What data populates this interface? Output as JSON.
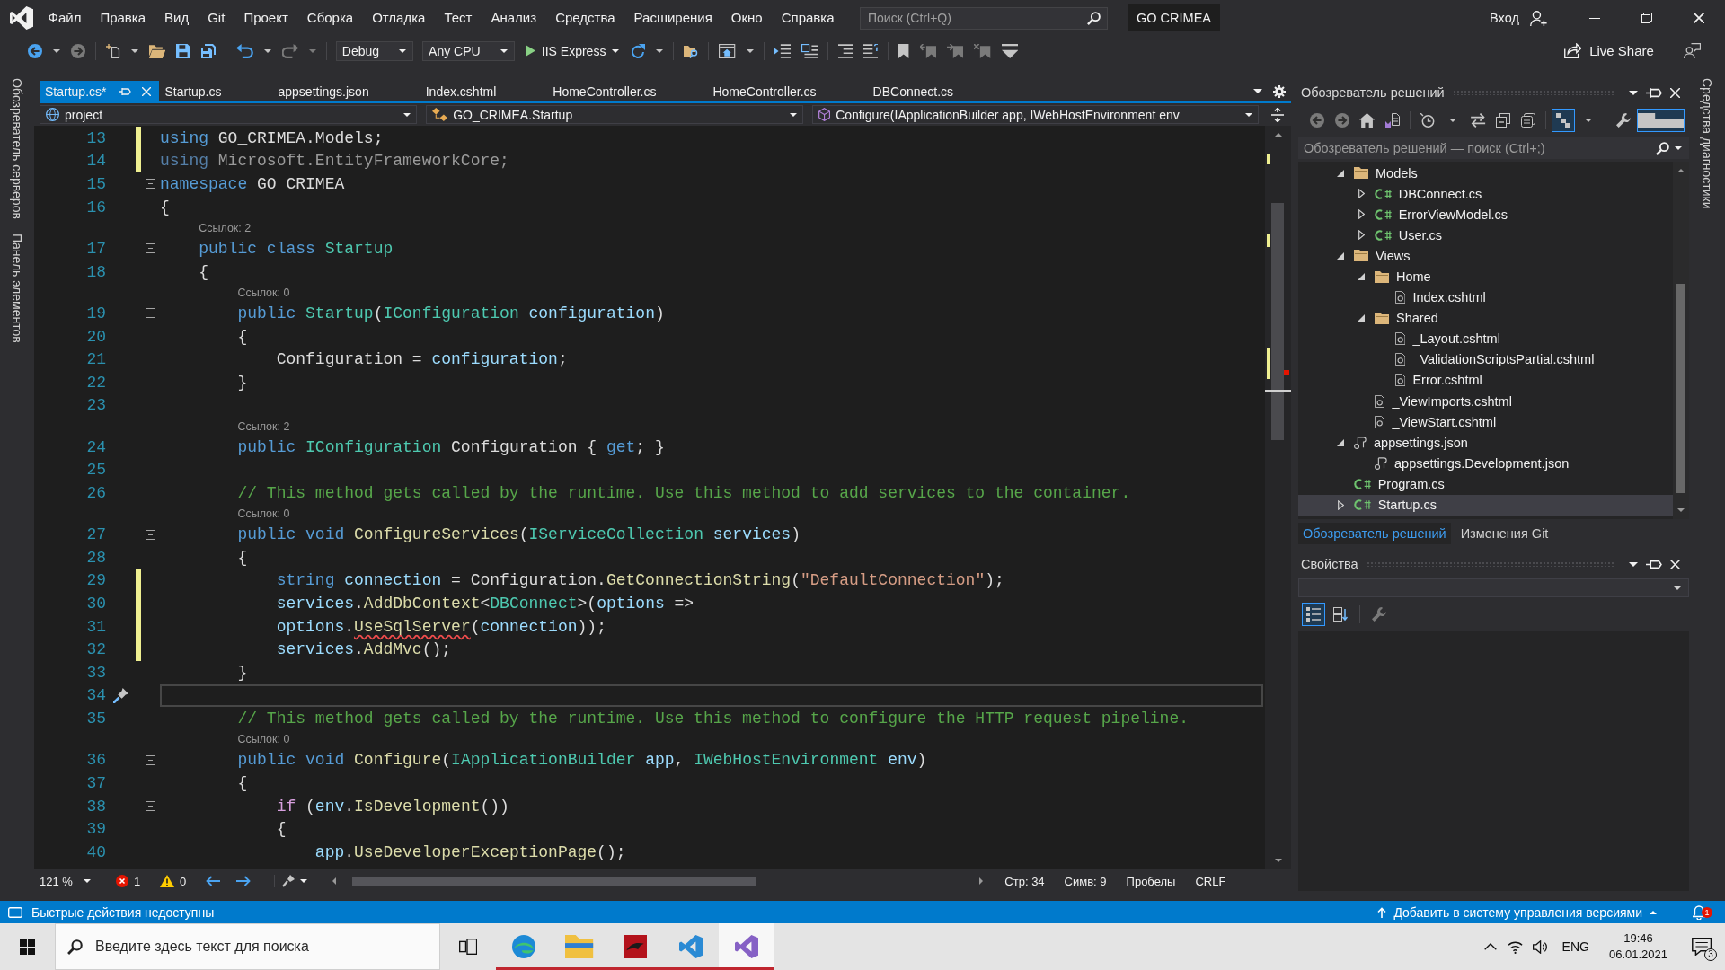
{
  "title_bar": {
    "menu": [
      "Файл",
      "Правка",
      "Вид",
      "Git",
      "Проект",
      "Сборка",
      "Отладка",
      "Тест",
      "Анализ",
      "Средства",
      "Расширения",
      "Окно",
      "Справка"
    ],
    "search": {
      "placeholder": "Поиск (Ctrl+Q)"
    },
    "solution_name": "GO CRIMEA",
    "sign_in": "Вход"
  },
  "toolbar": {
    "items": [
      {
        "kind": "back",
        "disabled": false
      },
      {
        "kind": "caret",
        "disabled": false
      },
      {
        "kind": "forward",
        "disabled": true
      },
      {
        "kind": "separator"
      },
      {
        "kind": "new_item",
        "disabled": false
      },
      {
        "kind": "caret",
        "disabled": false
      },
      {
        "kind": "open",
        "disabled": false
      },
      {
        "kind": "save",
        "disabled": false
      },
      {
        "kind": "save_all",
        "disabled": false
      },
      {
        "kind": "separator"
      },
      {
        "kind": "undo",
        "disabled": false
      },
      {
        "kind": "caret",
        "disabled": false
      },
      {
        "kind": "redo",
        "disabled": true
      },
      {
        "kind": "caret",
        "disabled": true
      },
      {
        "kind": "separator"
      },
      {
        "kind": "dropdown",
        "value": "Debug"
      },
      {
        "kind": "dropdown",
        "value": "Any CPU"
      },
      {
        "kind": "run",
        "label": "IIS Express"
      },
      {
        "kind": "refresh",
        "disabled": false
      },
      {
        "kind": "caret",
        "disabled": false
      },
      {
        "kind": "separator"
      },
      {
        "kind": "find",
        "disabled": false
      },
      {
        "kind": "separator"
      },
      {
        "kind": "browser",
        "disabled": false
      },
      {
        "kind": "caret",
        "disabled": false
      },
      {
        "kind": "separator"
      },
      {
        "kind": "member_list",
        "disabled": false
      },
      {
        "kind": "param_info",
        "disabled": false
      },
      {
        "kind": "separator"
      },
      {
        "kind": "outdent",
        "disabled": false
      },
      {
        "kind": "indent",
        "disabled": false
      },
      {
        "kind": "separator"
      },
      {
        "kind": "bookmark",
        "disabled": false
      },
      {
        "kind": "prev_bookmark",
        "disabled": true
      },
      {
        "kind": "next_bookmark",
        "disabled": true
      },
      {
        "kind": "clear_bookmarks",
        "disabled": true
      },
      {
        "kind": "overflow",
        "disabled": false
      }
    ],
    "live_share": "Live Share"
  },
  "side_tabs": {
    "left": [
      "Обозреватель серверов",
      "Панель элементов"
    ],
    "right": [
      "Средства диагностики"
    ]
  },
  "editor": {
    "tabs": [
      {
        "label": "Startup.cs*",
        "selected": true
      },
      {
        "label": "Startup.cs",
        "selected": false
      },
      {
        "label": "appsettings.json",
        "selected": false
      },
      {
        "label": "Index.cshtml",
        "selected": false
      },
      {
        "label": "HomeController.cs",
        "selected": false
      },
      {
        "label": "HomeController.cs",
        "selected": false
      },
      {
        "label": "DBConnect.cs",
        "selected": false
      }
    ],
    "navigation": [
      {
        "kind": "project",
        "value": "project"
      },
      {
        "kind": "class",
        "value": "GO_CRIMEA.Startup"
      },
      {
        "kind": "member",
        "value": "Configure(IApplicationBuilder app, IWebHostEnvironment env"
      }
    ],
    "lines": [
      {
        "number": "13",
        "changed": true,
        "fold": false,
        "current": false,
        "tokens": [
          {
            "kind": "keyword",
            "text": "using"
          },
          {
            "kind": "plain",
            "text": " GO_CRIMEA.Models;"
          }
        ]
      },
      {
        "number": "14",
        "changed": true,
        "fold": false,
        "current": false,
        "tokens": [
          {
            "kind": "faded_keyword",
            "text": "using"
          },
          {
            "kind": "faded",
            "text": " Microsoft.EntityFrameworkCore;"
          }
        ]
      },
      {
        "number": "15",
        "changed": false,
        "fold": true,
        "current": false,
        "tokens": [
          {
            "kind": "keyword",
            "text": "namespace"
          },
          {
            "kind": "plain",
            "text": " GO_CRIMEA"
          }
        ]
      },
      {
        "number": "16",
        "changed": false,
        "fold": false,
        "current": false,
        "tokens": [
          {
            "kind": "plain",
            "text": "{"
          }
        ]
      },
      {
        "number": "17",
        "codelens": "Ссылок: 2",
        "changed": false,
        "fold": true,
        "current": false,
        "tokens": [
          {
            "kind": "keyword",
            "text": "    public class"
          },
          {
            "kind": "type",
            "text": " Startup"
          }
        ]
      },
      {
        "number": "18",
        "changed": false,
        "fold": false,
        "current": false,
        "tokens": [
          {
            "kind": "plain",
            "text": "    {"
          }
        ]
      },
      {
        "number": "19",
        "codelens": "Ссылок: 0",
        "changed": false,
        "fold": true,
        "current": false,
        "tokens": [
          {
            "kind": "keyword",
            "text": "        public"
          },
          {
            "kind": "type",
            "text": " Startup"
          },
          {
            "kind": "plain",
            "text": "("
          },
          {
            "kind": "type",
            "text": "IConfiguration"
          },
          {
            "kind": "param",
            "text": " configuration"
          },
          {
            "kind": "plain",
            "text": ")"
          }
        ]
      },
      {
        "number": "20",
        "changed": false,
        "fold": false,
        "current": false,
        "tokens": [
          {
            "kind": "plain",
            "text": "        {"
          }
        ]
      },
      {
        "number": "21",
        "changed": false,
        "fold": false,
        "current": false,
        "tokens": [
          {
            "kind": "plain",
            "text": "            Configuration = "
          },
          {
            "kind": "param",
            "text": "configuration"
          },
          {
            "kind": "plain",
            "text": ";"
          }
        ]
      },
      {
        "number": "22",
        "changed": false,
        "fold": false,
        "current": false,
        "tokens": [
          {
            "kind": "plain",
            "text": "        }"
          }
        ]
      },
      {
        "number": "23",
        "changed": false,
        "fold": false,
        "current": false
      },
      {
        "number": "24",
        "codelens": "Ссылок: 2",
        "changed": false,
        "fold": false,
        "current": false,
        "tokens": [
          {
            "kind": "keyword",
            "text": "        public"
          },
          {
            "kind": "type",
            "text": " IConfiguration"
          },
          {
            "kind": "plain",
            "text": " Configuration { "
          },
          {
            "kind": "keyword",
            "text": "get"
          },
          {
            "kind": "plain",
            "text": "; }"
          }
        ]
      },
      {
        "number": "25",
        "changed": false,
        "fold": false,
        "current": false
      },
      {
        "number": "26",
        "changed": false,
        "fold": false,
        "current": false,
        "tokens": [
          {
            "kind": "comment",
            "text": "        // This method gets called by the runtime. Use this method to add services to the container."
          }
        ]
      },
      {
        "number": "27",
        "codelens": "Ссылок: 0",
        "changed": false,
        "fold": true,
        "current": false,
        "tokens": [
          {
            "kind": "keyword",
            "text": "        public void"
          },
          {
            "kind": "method",
            "text": " ConfigureServices"
          },
          {
            "kind": "plain",
            "text": "("
          },
          {
            "kind": "type",
            "text": "IServiceCollection"
          },
          {
            "kind": "param",
            "text": " services"
          },
          {
            "kind": "plain",
            "text": ")"
          }
        ]
      },
      {
        "number": "28",
        "changed": false,
        "fold": false,
        "current": false,
        "tokens": [
          {
            "kind": "plain",
            "text": "        {"
          }
        ]
      },
      {
        "number": "29",
        "changed": true,
        "fold": false,
        "current": false,
        "tokens": [
          {
            "kind": "keyword",
            "text": "            string"
          },
          {
            "kind": "param",
            "text": " connection"
          },
          {
            "kind": "plain",
            "text": " = Configuration."
          },
          {
            "kind": "method",
            "text": "GetConnectionString"
          },
          {
            "kind": "plain",
            "text": "("
          },
          {
            "kind": "string",
            "text": "\"DefaultConnection\""
          },
          {
            "kind": "plain",
            "text": ");"
          }
        ]
      },
      {
        "number": "30",
        "changed": true,
        "fold": false,
        "current": false,
        "tokens": [
          {
            "kind": "param",
            "text": "            services"
          },
          {
            "kind": "plain",
            "text": "."
          },
          {
            "kind": "method",
            "text": "AddDbContext"
          },
          {
            "kind": "plain",
            "text": "<"
          },
          {
            "kind": "type",
            "text": "DBConnect"
          },
          {
            "kind": "plain",
            "text": ">("
          },
          {
            "kind": "param",
            "text": "options"
          },
          {
            "kind": "plain",
            "text": " =>"
          }
        ]
      },
      {
        "number": "31",
        "changed": true,
        "fold": false,
        "current": false,
        "tokens": [
          {
            "kind": "param",
            "text": "            options"
          },
          {
            "kind": "plain",
            "text": "."
          },
          {
            "kind": "method_error",
            "text": "UseSqlServer"
          },
          {
            "kind": "plain",
            "text": "("
          },
          {
            "kind": "param",
            "text": "connection"
          },
          {
            "kind": "plain",
            "text": "));"
          }
        ]
      },
      {
        "number": "32",
        "changed": true,
        "fold": false,
        "current": false,
        "tokens": [
          {
            "kind": "param",
            "text": "            services"
          },
          {
            "kind": "plain",
            "text": "."
          },
          {
            "kind": "method",
            "text": "AddMvc"
          },
          {
            "kind": "plain",
            "text": "();"
          }
        ]
      },
      {
        "number": "33",
        "changed": false,
        "fold": false,
        "current": false,
        "tokens": [
          {
            "kind": "plain",
            "text": "        }"
          }
        ]
      },
      {
        "number": "34",
        "changed": false,
        "fold": false,
        "current": true
      },
      {
        "number": "35",
        "changed": false,
        "fold": false,
        "current": false,
        "tokens": [
          {
            "kind": "comment",
            "text": "        // This method gets called by the runtime. Use this method to configure the HTTP request pipeline."
          }
        ]
      },
      {
        "number": "36",
        "codelens": "Ссылок: 0",
        "changed": false,
        "fold": true,
        "current": false,
        "tokens": [
          {
            "kind": "keyword",
            "text": "        public void"
          },
          {
            "kind": "method",
            "text": " Configure"
          },
          {
            "kind": "plain",
            "text": "("
          },
          {
            "kind": "type",
            "text": "IApplicationBuilder"
          },
          {
            "kind": "param",
            "text": " app"
          },
          {
            "kind": "plain",
            "text": ", "
          },
          {
            "kind": "type",
            "text": "IWebHostEnvironment"
          },
          {
            "kind": "param",
            "text": " env"
          },
          {
            "kind": "plain",
            "text": ")"
          }
        ]
      },
      {
        "number": "37",
        "changed": false,
        "fold": false,
        "current": false,
        "tokens": [
          {
            "kind": "plain",
            "text": "        {"
          }
        ]
      },
      {
        "number": "38",
        "changed": false,
        "fold": true,
        "current": false,
        "tokens": [
          {
            "kind": "control",
            "text": "            if"
          },
          {
            "kind": "plain",
            "text": " ("
          },
          {
            "kind": "param",
            "text": "env"
          },
          {
            "kind": "plain",
            "text": "."
          },
          {
            "kind": "method",
            "text": "IsDevelopment"
          },
          {
            "kind": "plain",
            "text": "())"
          }
        ]
      },
      {
        "number": "39",
        "changed": false,
        "fold": false,
        "current": false,
        "tokens": [
          {
            "kind": "plain",
            "text": "            {"
          }
        ]
      },
      {
        "number": "40",
        "changed": false,
        "fold": false,
        "current": false,
        "tokens": [
          {
            "kind": "param",
            "text": "                app"
          },
          {
            "kind": "plain",
            "text": "."
          },
          {
            "kind": "method",
            "text": "UseDeveloperExceptionPage"
          },
          {
            "kind": "plain",
            "text": "();"
          }
        ]
      }
    ],
    "zoom": "121 %",
    "errors": "1",
    "warnings": "0",
    "position": [
      "Стр: 34",
      "Симв: 9",
      "Пробелы",
      "CRLF"
    ]
  },
  "solution_explorer": {
    "title": "Обозреватель решений",
    "toolbar": [
      {
        "kind": "back",
        "disabled": true,
        "on": false
      },
      {
        "kind": "forward",
        "disabled": true,
        "on": false
      },
      {
        "kind": "home",
        "disabled": false,
        "on": false
      },
      {
        "kind": "views",
        "disabled": false,
        "on": false
      },
      {
        "kind": "separator"
      },
      {
        "kind": "history",
        "disabled": false,
        "on": false
      },
      {
        "kind": "caret",
        "disabled": false,
        "on": false
      },
      {
        "kind": "sync",
        "disabled": false,
        "on": false
      },
      {
        "kind": "collapse",
        "disabled": false,
        "on": false
      },
      {
        "kind": "show_all",
        "disabled": false,
        "on": false
      },
      {
        "kind": "separator"
      },
      {
        "kind": "tree",
        "disabled": false,
        "on": true
      },
      {
        "kind": "caret",
        "disabled": false,
        "on": false
      },
      {
        "kind": "separator"
      },
      {
        "kind": "wrench",
        "disabled": false,
        "on": false
      },
      {
        "kind": "preview",
        "disabled": false,
        "on": true
      }
    ],
    "search": {
      "placeholder": "Обозреватель решений — поиск (Ctrl+;)"
    },
    "tree": [
      {
        "label": "Models",
        "kind": "folder",
        "expanded": true,
        "selected": false,
        "children": [
          {
            "label": "DBConnect.cs",
            "kind": "csharp",
            "expanded": false,
            "selected": false
          },
          {
            "label": "ErrorViewModel.cs",
            "kind": "csharp",
            "expanded": false,
            "selected": false
          },
          {
            "label": "User.cs",
            "kind": "csharp",
            "expanded": false,
            "selected": false
          }
        ]
      },
      {
        "label": "Views",
        "kind": "folder",
        "expanded": true,
        "selected": false,
        "children": [
          {
            "label": "Home",
            "kind": "folder",
            "expanded": true,
            "selected": false,
            "children": [
              {
                "label": "Index.cshtml",
                "kind": "razor",
                "selected": false
              }
            ]
          },
          {
            "label": "Shared",
            "kind": "folder",
            "expanded": true,
            "selected": false,
            "children": [
              {
                "label": "_Layout.cshtml",
                "kind": "razor",
                "selected": false
              },
              {
                "label": "_ValidationScriptsPartial.cshtml",
                "kind": "razor",
                "selected": false
              },
              {
                "label": "Error.cshtml",
                "kind": "razor",
                "selected": false
              }
            ]
          },
          {
            "label": "_ViewImports.cshtml",
            "kind": "razor",
            "selected": false
          },
          {
            "label": "_ViewStart.cshtml",
            "kind": "razor",
            "selected": false
          }
        ]
      },
      {
        "label": "appsettings.json",
        "kind": "json",
        "expanded": true,
        "selected": false,
        "children": [
          {
            "label": "appsettings.Development.json",
            "kind": "json",
            "selected": false
          }
        ]
      },
      {
        "label": "Program.cs",
        "kind": "csharp",
        "selected": false
      },
      {
        "label": "Startup.cs",
        "kind": "csharp",
        "expanded": false,
        "selected": true
      }
    ],
    "tabs": [
      {
        "label": "Обозреватель решений",
        "selected": true
      },
      {
        "label": "Изменения Git",
        "selected": false
      }
    ]
  },
  "properties": {
    "title": "Свойства",
    "toolbar": [
      {
        "kind": "categorized",
        "disabled": false,
        "on": true
      },
      {
        "kind": "alphabetical",
        "disabled": false,
        "on": false
      },
      {
        "kind": "separator"
      },
      {
        "kind": "property_pages",
        "disabled": true,
        "on": false
      }
    ]
  },
  "status_bar": {
    "message": "Быстрые действия недоступны",
    "source_control": "Добавить в систему управления версиями",
    "notifications": "1"
  },
  "taskbar": {
    "search": {
      "placeholder": "Введите здесь текст для поиска"
    },
    "apps": [
      {
        "kind": "task_view",
        "running": false,
        "selected": false
      },
      {
        "kind": "browser",
        "running": true,
        "selected": false
      },
      {
        "kind": "files",
        "running": true,
        "selected": false
      },
      {
        "kind": "app",
        "running": true,
        "selected": false
      },
      {
        "kind": "code_editor",
        "running": true,
        "selected": false
      },
      {
        "kind": "ide",
        "running": true,
        "selected": true
      }
    ],
    "language": "ENG",
    "time": "19:46",
    "date": "06.01.2021",
    "notifications": "3"
  }
}
